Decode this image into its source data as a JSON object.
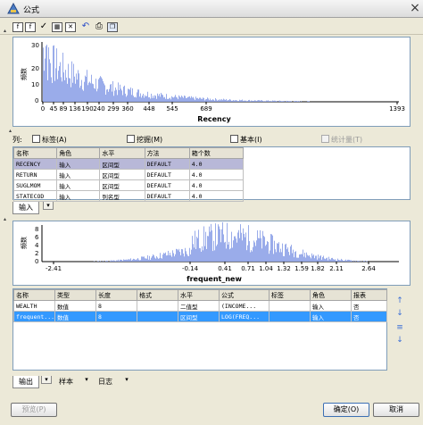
{
  "window": {
    "title": "公式",
    "close_glyph": "×"
  },
  "toolbar": {
    "icons": [
      "expr-f-icon",
      "expr-f2-icon",
      "check-icon",
      "table-icon",
      "delete-icon",
      "undo-icon",
      "print-icon",
      "copy-icon"
    ],
    "check_glyph": "✓"
  },
  "top_chart": {
    "ylabel": "频数",
    "xlabel": "Recency",
    "y_ticks": [
      "30",
      "20",
      "10",
      "0"
    ],
    "x_ticks": [
      "0",
      "45",
      "89",
      "136",
      "190",
      "240",
      "299",
      "360",
      "448",
      "545",
      "689",
      "1393"
    ]
  },
  "field_filter": {
    "label": "列:",
    "options": [
      {
        "label": "标签(A)",
        "checked": false,
        "enabled": true
      },
      {
        "label": "挖掘(M)",
        "checked": false,
        "enabled": true
      },
      {
        "label": "基本(I)",
        "checked": false,
        "enabled": true
      },
      {
        "label": "统计量(T)",
        "checked": false,
        "enabled": false
      }
    ]
  },
  "input_table": {
    "headers": [
      "名称",
      "角色",
      "水平",
      "方法",
      "箱个数"
    ],
    "rows": [
      [
        "RECENCY",
        "输入",
        "区间型",
        "DEFAULT",
        "4.0"
      ],
      [
        "RETURN",
        "输入",
        "区间型",
        "DEFAULT",
        "4.0"
      ],
      [
        "SUGLMOM",
        "输入",
        "区间型",
        "DEFAULT",
        "4.0"
      ],
      [
        "STATECOD",
        "输入",
        "列名型",
        "DEFAULT",
        "4.0"
      ]
    ],
    "selected_row": 0
  },
  "input_tab": {
    "label": "输入",
    "dropdown": "▾"
  },
  "bottom_chart": {
    "ylabel": "频数",
    "xlabel": "frequent_new",
    "y_ticks": [
      "8",
      "6",
      "4",
      "2",
      "0"
    ],
    "x_ticks": [
      "-2.41",
      "-0.14",
      "0.41",
      "0.71",
      "1.04",
      "1.32",
      "1.59",
      "1.82",
      "2.11",
      "2.64"
    ]
  },
  "output_table": {
    "headers": [
      "名称",
      "类型",
      "长度",
      "格式",
      "水平",
      "公式",
      "标签",
      "角色",
      "报表"
    ],
    "rows": [
      [
        "WEALTH",
        "数值",
        "8",
        "",
        "二值型",
        "(INCOME...",
        "",
        "输入",
        "否"
      ],
      [
        "frequent...",
        "数值",
        "8",
        "",
        "区间型",
        "LOG(FREQ...",
        "",
        "输入",
        "否"
      ]
    ],
    "selected_row": 1
  },
  "side_buttons": [
    "↑",
    "↓",
    "≡",
    "↓"
  ],
  "bottom_tabs": [
    {
      "label": "输出",
      "dropdown": "▾"
    },
    {
      "label": "样本",
      "dropdown": "▾"
    },
    {
      "label": "日志",
      "dropdown": "▾"
    }
  ],
  "buttons": {
    "preview": "预览(P)",
    "ok": "确定(O)",
    "cancel": "取消"
  }
}
